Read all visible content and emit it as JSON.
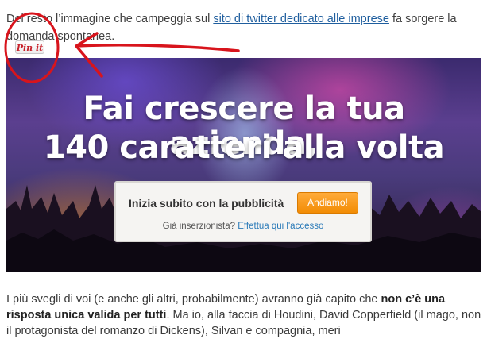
{
  "article": {
    "intro": {
      "prefix": "Del resto l’immagine che campeggia sul ",
      "link": "sito di twitter dedicato alle imprese",
      "suffix": " fa sorgere la domanda spontanea."
    },
    "pin_button": "Pin it",
    "hero": {
      "title_line1": "Fai crescere la tua azienda,",
      "title_line2": "140 caratteri alla volta",
      "cta_text": "Inizia subito con la pubblicità",
      "cta_button": "Andiamo!",
      "cta_question": "Già inserzionista?",
      "cta_link": "Effettua qui l'accesso"
    },
    "body": {
      "part1": "I più svegli di voi (e anche gli altri, probabilmente) avranno già capito che ",
      "bold": "non c’è una risposta unica valida per tutti",
      "part2": ". Ma io, alla faccia di Houdini, David Copperfield (il mago, non il protagonista del romanzo di Dickens), Silvan e compagnia, meri"
    }
  },
  "colors": {
    "link": "#1f5e9e",
    "annotation_red": "#d8141c",
    "cta_orange": "#f7941d",
    "pin_red": "#c8232c"
  }
}
